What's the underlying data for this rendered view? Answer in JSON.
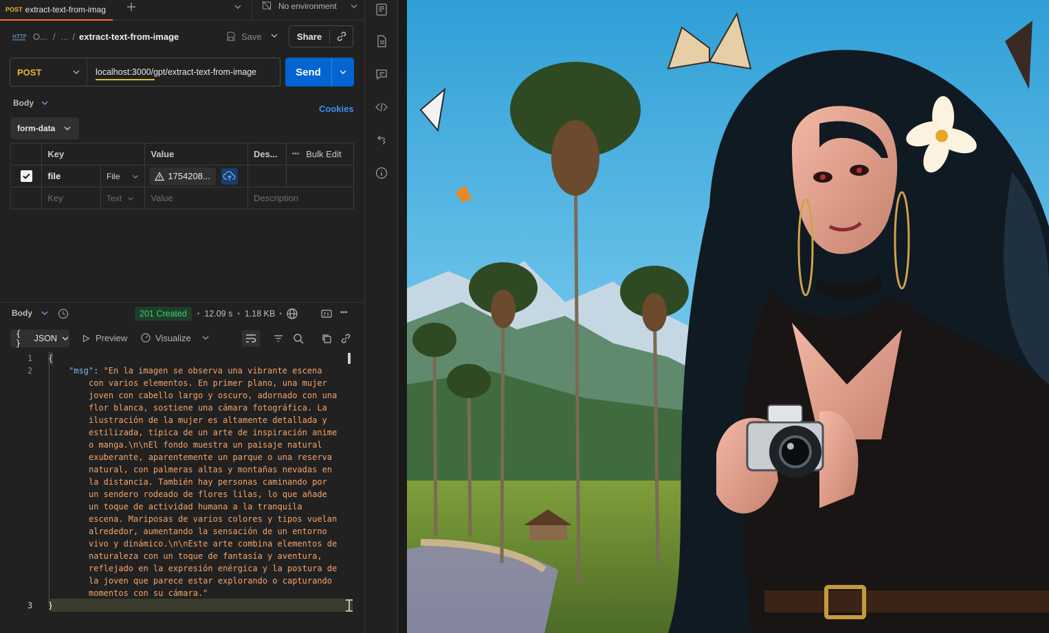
{
  "tab": {
    "method": "POST",
    "name": "extract-text-from-imag"
  },
  "environment": {
    "label": "No environment"
  },
  "breadcrumb": {
    "part1": "O...",
    "part2": "...",
    "title": "extract-text-from-image"
  },
  "toolbar": {
    "save_label": "Save",
    "share_label": "Share"
  },
  "request": {
    "method": "POST",
    "url": "localhost:3000/gpt/extract-text-from-image",
    "send_label": "Send"
  },
  "body_section": {
    "label": "Body",
    "cookies_label": "Cookies",
    "mode": "form-data"
  },
  "params_table": {
    "headers": {
      "key": "Key",
      "value": "Value",
      "description": "Des...",
      "bulk_edit": "Bulk Edit"
    },
    "row": {
      "key": "file",
      "type": "File",
      "value": "1754208..."
    },
    "placeholder": {
      "key": "Key",
      "type": "Text",
      "value": "Value",
      "description": "Description"
    }
  },
  "response": {
    "body_label": "Body",
    "status": "201 Created",
    "time": "12.09 s",
    "size": "1.18 KB",
    "format": "JSON",
    "preview_label": "Preview",
    "visualize_label": "Visualize",
    "line_numbers": [
      "1",
      "2",
      "3"
    ],
    "open_brace": "{",
    "close_brace": "}",
    "json_key": "\"msg\"",
    "json_lines": [
      "\"En la imagen se observa una vibrante escena",
      "con varios elementos. En primer plano, una mujer",
      "joven con cabello largo y oscuro, adornado con una",
      "flor blanca, sostiene una cámara fotográfica. La",
      "ilustración de la mujer es altamente detallada y",
      "estilizada, típica de un arte de inspiración anime",
      "o manga.\\n\\nEl fondo muestra un paisaje natural",
      "exuberante, aparentemente un parque o una reserva",
      "natural, con palmeras altas y montañas nevadas en",
      "la distancia. También hay personas caminando por",
      "un sendero rodeado de flores lilas, lo que añade",
      "un toque de actividad humana a la tranquila",
      "escena. Mariposas de varios colores y tipos vuelan",
      "alrededor, aumentando la sensación de un entorno",
      "vivo y dinámico.\\n\\nEste arte combina elementos de",
      "naturaleza con un toque de fantasía y aventura,",
      "reflejado en la expresión enérgica y la postura de",
      "la joven que parece estar explorando o capturando",
      "momentos con su cámara.\""
    ]
  },
  "colors": {
    "accent": "#ff6c37",
    "send": "#0265d2",
    "status_green": "#3bd06b",
    "method_yellow": "#e5b92f"
  }
}
